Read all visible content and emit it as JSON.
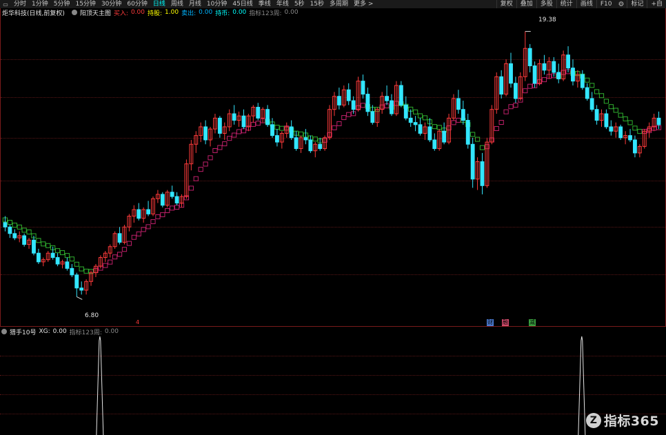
{
  "toolbar": {
    "periods": [
      "分时",
      "1分钟",
      "5分钟",
      "15分钟",
      "30分钟",
      "60分钟",
      "日线",
      "周线",
      "月线",
      "10分钟",
      "45日线",
      "季线",
      "年线",
      "5秒",
      "15秒",
      "多周期",
      "更多 >"
    ],
    "active_period": "日线",
    "right_buttons": [
      "复权",
      "叠加",
      "多股",
      "统计",
      "画线",
      "F10",
      "标记",
      "+自"
    ]
  },
  "main_legend": {
    "stock_title": "炬华科技(日线,前复权)",
    "formula_name": "阳顶天主图",
    "buy_label": "买入:",
    "buy_value": "0.00",
    "hold_label": "持股:",
    "hold_value": "1.00",
    "sell_label": "卖出:",
    "sell_value": "0.00",
    "coin_label": "持币:",
    "coin_value": "0.00",
    "indicator_label": "指标123周:",
    "indicator_value": "0.00"
  },
  "price_annotations": {
    "high": "19.38",
    "low": "6.80"
  },
  "event_badges": [
    {
      "text": "财",
      "color": "#4a7ad0"
    },
    {
      "text": "融",
      "color": "#d04a6a"
    },
    {
      "text": "减",
      "color": "#3aa040"
    }
  ],
  "marker_char": "4",
  "sub_legend": {
    "name": "猎手10号",
    "xg_label": "XG:",
    "xg_value": "0.00",
    "indicator_label": "指标123周:",
    "indicator_value": "0.00"
  },
  "watermark": {
    "logo": "Z",
    "text": "指标365"
  },
  "colors": {
    "up": "#ff3b3b",
    "down": "#33e6ff",
    "line_up": "#c0206a",
    "line_down": "#2fb02f"
  },
  "chart_data": {
    "type": "candlestick",
    "y_range": [
      6.2,
      20.0
    ],
    "trend_start": 10.8,
    "candles": [
      [
        10.6,
        10.9,
        10.2,
        10.4
      ],
      [
        10.4,
        10.5,
        9.9,
        10.1
      ],
      [
        10.1,
        10.3,
        9.8,
        9.9
      ],
      [
        9.9,
        10.2,
        9.7,
        10.0
      ],
      [
        10.0,
        10.1,
        9.5,
        9.6
      ],
      [
        9.6,
        9.9,
        9.4,
        9.8
      ],
      [
        9.8,
        10.0,
        9.1,
        9.2
      ],
      [
        9.2,
        9.4,
        8.7,
        8.8
      ],
      [
        8.8,
        9.0,
        8.6,
        8.9
      ],
      [
        8.9,
        9.3,
        8.8,
        9.2
      ],
      [
        9.2,
        9.5,
        8.9,
        9.0
      ],
      [
        9.0,
        9.2,
        8.6,
        8.7
      ],
      [
        8.7,
        8.9,
        8.5,
        8.8
      ],
      [
        8.8,
        9.0,
        8.4,
        8.5
      ],
      [
        8.5,
        8.7,
        8.1,
        8.2
      ],
      [
        8.2,
        8.3,
        7.2,
        7.6
      ],
      [
        7.6,
        7.9,
        7.3,
        7.5
      ],
      [
        7.5,
        8.0,
        7.3,
        7.9
      ],
      [
        7.9,
        8.4,
        7.7,
        8.3
      ],
      [
        8.3,
        8.7,
        8.1,
        8.6
      ],
      [
        8.6,
        9.1,
        8.5,
        9.0
      ],
      [
        9.0,
        9.3,
        8.8,
        9.2
      ],
      [
        9.2,
        9.6,
        9.0,
        9.5
      ],
      [
        9.5,
        10.2,
        9.4,
        10.1
      ],
      [
        10.1,
        10.4,
        9.6,
        9.7
      ],
      [
        9.7,
        10.5,
        9.6,
        10.4
      ],
      [
        10.4,
        11.0,
        10.2,
        10.9
      ],
      [
        10.9,
        11.4,
        10.6,
        11.2
      ],
      [
        11.2,
        11.5,
        10.7,
        10.8
      ],
      [
        10.8,
        11.3,
        10.6,
        11.2
      ],
      [
        11.2,
        11.6,
        10.9,
        11.0
      ],
      [
        11.0,
        11.8,
        10.9,
        11.7
      ],
      [
        11.7,
        12.1,
        11.5,
        11.9
      ],
      [
        11.9,
        12.0,
        11.3,
        11.4
      ],
      [
        11.4,
        12.1,
        11.3,
        12.0
      ],
      [
        12.0,
        12.3,
        11.7,
        11.8
      ],
      [
        11.8,
        12.0,
        11.4,
        11.5
      ],
      [
        11.5,
        11.9,
        11.3,
        11.8
      ],
      [
        11.8,
        13.5,
        11.7,
        13.3
      ],
      [
        13.3,
        14.4,
        13.0,
        14.2
      ],
      [
        14.2,
        14.8,
        13.8,
        14.6
      ],
      [
        14.6,
        15.2,
        14.3,
        15.0
      ],
      [
        15.0,
        15.3,
        14.2,
        14.4
      ],
      [
        14.4,
        15.0,
        14.1,
        14.9
      ],
      [
        14.9,
        15.6,
        14.7,
        15.4
      ],
      [
        15.4,
        15.5,
        14.5,
        14.7
      ],
      [
        14.7,
        15.2,
        14.4,
        15.0
      ],
      [
        15.0,
        15.8,
        14.8,
        15.6
      ],
      [
        15.6,
        16.0,
        15.1,
        15.3
      ],
      [
        15.3,
        15.7,
        15.0,
        15.5
      ],
      [
        15.5,
        15.8,
        14.9,
        15.0
      ],
      [
        15.0,
        15.6,
        14.8,
        15.5
      ],
      [
        15.5,
        16.0,
        15.2,
        15.9
      ],
      [
        15.9,
        16.1,
        15.3,
        15.4
      ],
      [
        15.4,
        15.9,
        15.2,
        15.8
      ],
      [
        15.8,
        16.0,
        15.0,
        15.1
      ],
      [
        15.1,
        15.4,
        14.5,
        14.6
      ],
      [
        14.6,
        14.9,
        14.1,
        14.3
      ],
      [
        14.3,
        14.8,
        14.0,
        14.7
      ],
      [
        14.7,
        15.2,
        14.5,
        15.0
      ],
      [
        15.0,
        15.3,
        14.4,
        14.5
      ],
      [
        14.5,
        14.8,
        13.9,
        14.0
      ],
      [
        14.0,
        14.6,
        13.8,
        14.5
      ],
      [
        14.5,
        14.9,
        14.2,
        14.4
      ],
      [
        14.4,
        14.6,
        13.8,
        13.9
      ],
      [
        13.9,
        14.3,
        13.6,
        14.2
      ],
      [
        14.2,
        14.5,
        13.9,
        14.0
      ],
      [
        14.0,
        14.6,
        13.9,
        14.5
      ],
      [
        14.5,
        16.0,
        14.4,
        15.8
      ],
      [
        15.8,
        16.6,
        15.5,
        16.4
      ],
      [
        16.4,
        16.8,
        15.8,
        16.0
      ],
      [
        16.0,
        16.9,
        15.9,
        16.7
      ],
      [
        16.7,
        17.0,
        16.0,
        16.2
      ],
      [
        16.2,
        16.4,
        15.6,
        15.8
      ],
      [
        15.8,
        17.3,
        15.7,
        17.1
      ],
      [
        17.1,
        17.4,
        16.3,
        16.5
      ],
      [
        16.5,
        16.8,
        15.5,
        15.7
      ],
      [
        15.7,
        16.0,
        15.1,
        15.2
      ],
      [
        15.2,
        15.9,
        15.0,
        15.8
      ],
      [
        15.8,
        16.6,
        15.6,
        16.4
      ],
      [
        16.4,
        16.9,
        16.0,
        16.2
      ],
      [
        16.2,
        16.5,
        15.5,
        15.6
      ],
      [
        15.6,
        17.1,
        15.5,
        16.9
      ],
      [
        16.9,
        17.1,
        15.9,
        16.0
      ],
      [
        16.0,
        16.4,
        15.3,
        15.4
      ],
      [
        15.4,
        15.8,
        15.0,
        15.2
      ],
      [
        15.2,
        15.5,
        14.8,
        15.1
      ],
      [
        15.1,
        15.4,
        14.6,
        14.7
      ],
      [
        14.7,
        15.2,
        14.4,
        15.0
      ],
      [
        15.0,
        15.4,
        14.3,
        14.4
      ],
      [
        14.4,
        14.7,
        13.9,
        14.0
      ],
      [
        14.0,
        14.9,
        13.9,
        14.8
      ],
      [
        14.8,
        15.2,
        14.2,
        14.3
      ],
      [
        14.3,
        15.6,
        14.2,
        15.4
      ],
      [
        15.4,
        16.5,
        15.3,
        16.3
      ],
      [
        16.3,
        16.7,
        15.6,
        15.8
      ],
      [
        15.8,
        16.2,
        15.1,
        15.3
      ],
      [
        15.3,
        15.6,
        14.0,
        14.2
      ],
      [
        14.2,
        14.5,
        12.2,
        12.6
      ],
      [
        12.6,
        13.6,
        12.1,
        13.4
      ],
      [
        13.4,
        13.8,
        11.9,
        12.3
      ],
      [
        12.3,
        14.5,
        12.2,
        14.3
      ],
      [
        14.3,
        16.0,
        14.2,
        15.8
      ],
      [
        15.8,
        17.5,
        15.6,
        17.3
      ],
      [
        17.3,
        17.6,
        16.3,
        16.5
      ],
      [
        16.5,
        18.1,
        16.4,
        17.9
      ],
      [
        17.9,
        18.4,
        16.8,
        17.0
      ],
      [
        17.0,
        17.3,
        16.1,
        16.3
      ],
      [
        16.3,
        17.5,
        16.2,
        17.3
      ],
      [
        17.3,
        19.38,
        17.1,
        18.6
      ],
      [
        18.6,
        18.8,
        17.5,
        17.8
      ],
      [
        17.8,
        18.0,
        16.8,
        17.0
      ],
      [
        17.0,
        18.1,
        16.9,
        17.9
      ],
      [
        17.9,
        18.3,
        17.4,
        17.6
      ],
      [
        17.6,
        18.2,
        17.2,
        18.0
      ],
      [
        18.0,
        18.2,
        17.3,
        17.5
      ],
      [
        17.5,
        17.9,
        17.0,
        17.2
      ],
      [
        17.2,
        18.5,
        17.1,
        18.3
      ],
      [
        18.3,
        18.7,
        17.5,
        17.7
      ],
      [
        17.7,
        18.1,
        16.9,
        17.1
      ],
      [
        17.1,
        17.6,
        16.8,
        17.4
      ],
      [
        17.4,
        17.6,
        16.7,
        16.8
      ],
      [
        16.8,
        17.0,
        16.2,
        16.3
      ],
      [
        16.3,
        16.6,
        15.7,
        15.8
      ],
      [
        15.8,
        16.0,
        15.1,
        15.3
      ],
      [
        15.3,
        15.8,
        15.0,
        15.6
      ],
      [
        15.6,
        15.8,
        14.9,
        15.0
      ],
      [
        15.0,
        15.3,
        14.6,
        14.8
      ],
      [
        14.8,
        15.2,
        14.5,
        15.0
      ],
      [
        15.0,
        15.1,
        14.4,
        14.5
      ],
      [
        14.5,
        14.8,
        14.2,
        14.6
      ],
      [
        14.6,
        14.9,
        14.3,
        14.4
      ],
      [
        14.4,
        14.6,
        13.6,
        13.8
      ],
      [
        13.8,
        14.2,
        13.6,
        14.1
      ],
      [
        14.1,
        14.9,
        14.0,
        14.8
      ],
      [
        14.8,
        15.2,
        14.5,
        15.0
      ],
      [
        15.0,
        15.6,
        14.8,
        15.4
      ],
      [
        15.4,
        15.7,
        14.9,
        15.1
      ]
    ],
    "x_signals_at": [
      20,
      121
    ]
  }
}
